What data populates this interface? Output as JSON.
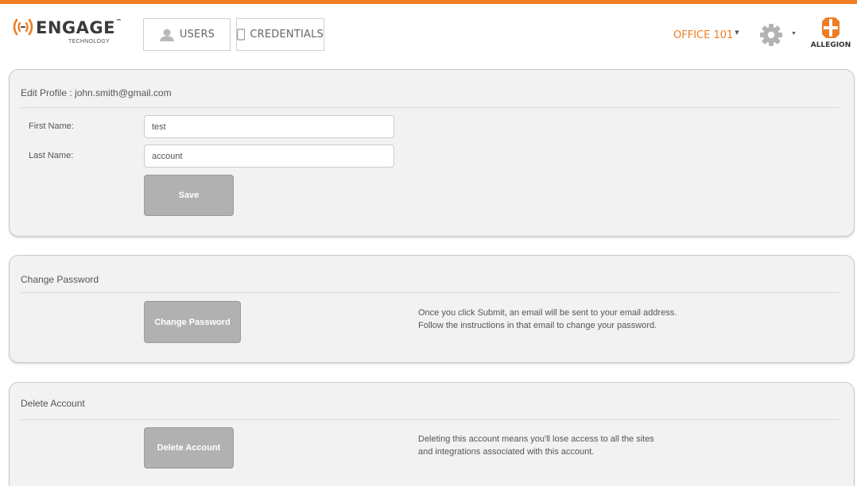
{
  "header": {
    "logo": {
      "word": "ENGAGE",
      "trademark": "™",
      "subtitle": "TECHNOLOGY"
    },
    "nav": {
      "users_label": "USERS",
      "credentials_label": "CREDENTIALS"
    },
    "site_selector": {
      "label": "OFFICE 101",
      "caret": "▼"
    },
    "settings": {
      "caret": "▼"
    },
    "brand": {
      "label": "ALLEGION"
    }
  },
  "edit_profile": {
    "title": "Edit Profile : john.smith@gmail.com",
    "first_name_label": "First Name:",
    "first_name_value": "test",
    "last_name_label": "Last Name:",
    "last_name_value": "account",
    "save_label": "Save"
  },
  "change_password": {
    "title": "Change Password",
    "button_label": "Change Password",
    "info_line1": "Once you click Submit, an email will be sent to your email address.",
    "info_line2": "Follow the instructions in that email to change your password."
  },
  "delete_account": {
    "title": "Delete Account",
    "button_label": "Delete Account",
    "info_line1": "Deleting this account means you'll lose access to all the sites",
    "info_line2": "and integrations associated with this account."
  },
  "colors": {
    "accent": "#ef7d22",
    "panel_bg": "#f2f2f2",
    "button_gray": "#b1b1b1"
  }
}
